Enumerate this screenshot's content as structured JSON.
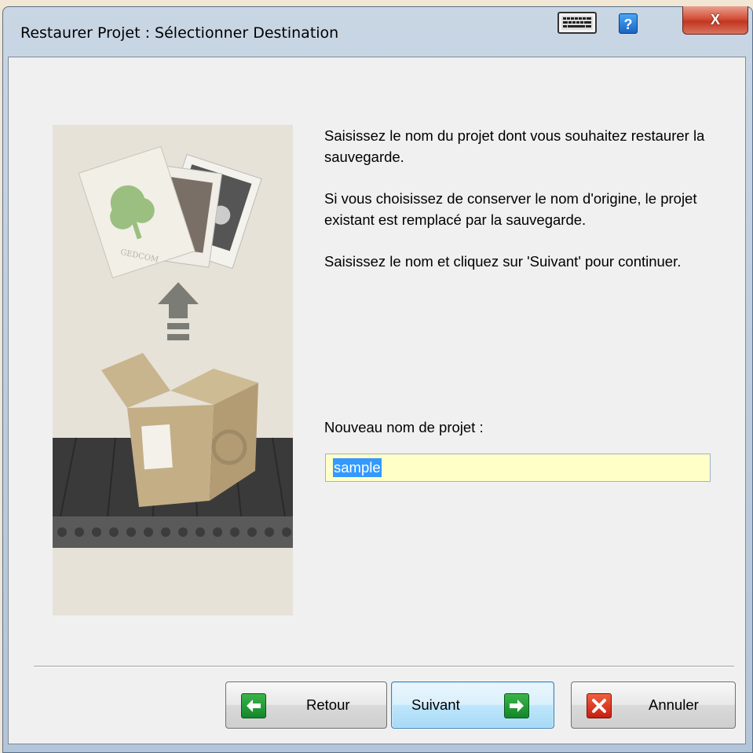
{
  "window": {
    "title": "Restaurer Projet : Sélectionner Destination"
  },
  "titlebar_buttons": {
    "help_label": "?",
    "close_label": "X"
  },
  "description": {
    "paragraph1": "Saisissez le nom du projet dont vous souhaitez restaurer la sauvegarde.",
    "paragraph2": "Si vous choisissez de conserver le nom d'origine, le projet existant est remplacé par la sauvegarde.",
    "paragraph3": "Saisissez le nom et cliquez sur 'Suivant' pour continuer."
  },
  "form": {
    "label": "Nouveau nom de projet :",
    "value": "sample"
  },
  "illustration": {
    "card_text": "GEDCOM"
  },
  "buttons": {
    "back_label": "Retour",
    "next_label": "Suivant",
    "cancel_label": "Annuler"
  },
  "colors": {
    "input_background": "#ffffc8",
    "selection": "#3399ff",
    "nav_icon_green": "#12872a",
    "cancel_icon_red": "#c81e10"
  }
}
